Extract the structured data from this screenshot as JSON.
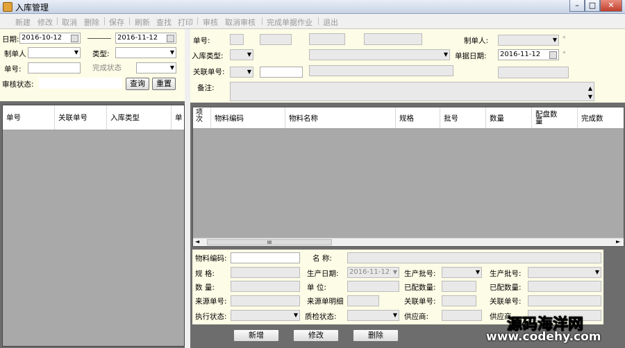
{
  "window": {
    "title": "入库管理",
    "min_label": "–",
    "max_label": "□",
    "close_label": "✕"
  },
  "toolbar": [
    "新建",
    "修改",
    "取消",
    "删除",
    "保存",
    "刷新",
    "查找",
    "打印",
    "审核",
    "取消审核",
    "完成单据作业",
    "退出"
  ],
  "filter": {
    "date_label": "日期:",
    "date_from": "2016-10-12",
    "date_to": "2016-11-12",
    "creator_label": "制单人",
    "type_label": "类型:",
    "bill_no_label": "单号:",
    "completion_label": "完成状态",
    "audit_label": "审核状态:",
    "query_btn": "查询",
    "reset_btn": "重置"
  },
  "left_grid": {
    "columns": [
      "单号",
      "关联单号",
      "入库类型",
      "单"
    ]
  },
  "header_form": {
    "bill_no_label": "单号:",
    "creator_label": "制单人:",
    "type_label": "入库类型:",
    "date_label": "单据日期:",
    "date_value": "2016-11-12",
    "related_label": "关联单号:",
    "remark_label": "备注:",
    "required_mark": "*"
  },
  "detail_grid": {
    "columns": [
      "项次",
      "物料编码",
      "物料名称",
      "规格",
      "批号",
      "数量",
      "配盘数量",
      "完成数"
    ],
    "scroll_thumb": "III"
  },
  "item_form": {
    "code_label": "物料编码:",
    "name_label": "名    称:",
    "spec_label": "规    格:",
    "prod_date_label": "生产日期:",
    "prod_date_value": "2016-11-12",
    "batch_label": "生产批号:",
    "batch_label2": "生产批号:",
    "qty_label": "数    量:",
    "unit_label": "单    位:",
    "alloc_label": "已配数量:",
    "alloc_label2": "已配数量:",
    "src_label": "来源单号:",
    "src_detail_label": "来源单明细",
    "related_label": "关联单号:",
    "related_label2": "关联单号:",
    "exec_label": "执行状态:",
    "qc_label": "质检状态:",
    "supplier_label": "供应商:",
    "supplier_label2": "供应商"
  },
  "bottom_buttons": {
    "add": "新增",
    "edit": "修改",
    "delete": "删除"
  },
  "watermark": {
    "line1": "源码海洋网",
    "line2": "www.codehy.com"
  }
}
